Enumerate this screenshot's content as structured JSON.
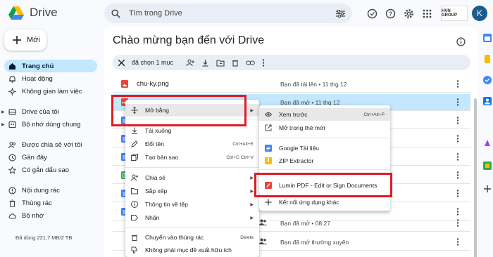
{
  "app": {
    "name": "Drive"
  },
  "search": {
    "placeholder": "Tìm trong Drive"
  },
  "header": {
    "brand_label": "HVN GROUP",
    "avatar_letter": "K"
  },
  "sidebar": {
    "new_label": "Mới",
    "items": [
      {
        "label": "Trang chủ",
        "icon": "home-icon",
        "active": true
      },
      {
        "label": "Hoạt động",
        "icon": "bell-icon"
      },
      {
        "label": "Không gian làm việc",
        "icon": "workspace-icon"
      },
      {
        "label": "Drive của tôi",
        "icon": "drive-icon"
      },
      {
        "label": "Bộ nhớ dùng chung",
        "icon": "shared-drive-icon"
      },
      {
        "label": "Được chia sẻ với tôi",
        "icon": "people-icon"
      },
      {
        "label": "Gần đây",
        "icon": "clock-icon"
      },
      {
        "label": "Có gắn dấu sao",
        "icon": "star-icon"
      },
      {
        "label": "Nội dung rác",
        "icon": "spam-icon"
      },
      {
        "label": "Thùng rác",
        "icon": "trash-icon"
      },
      {
        "label": "Bộ nhớ",
        "icon": "cloud-icon"
      }
    ],
    "storage_text": "Đã dùng 221,7 MB/2 TB"
  },
  "main": {
    "title": "Chào mừng bạn đến với Drive",
    "selection_text": "đã chọn 1 mục",
    "files": [
      {
        "name": "chu-ky.png",
        "reason": "Bạn đã tải lên • 11 thg 12",
        "type": "image"
      },
      {
        "name": "",
        "reason": "Bạn đã mở • 11 thg 12",
        "type": "pdf",
        "selected": true
      },
      {
        "name": "",
        "reason": "",
        "type": "doc"
      },
      {
        "name": "",
        "reason": "",
        "type": "doc"
      },
      {
        "name": "",
        "reason": "",
        "type": "doc"
      },
      {
        "name": "",
        "reason": "",
        "type": "sheet"
      },
      {
        "name": "",
        "reason": "",
        "type": "doc"
      },
      {
        "name": "",
        "reason": "",
        "type": "doc"
      },
      {
        "name": "",
        "reason": "Bạn đã mở • 08:27",
        "type": "shared"
      },
      {
        "name": "",
        "reason": "Bạn đã mở thường xuyên",
        "type": "sheet"
      }
    ]
  },
  "context_menu": {
    "items": [
      {
        "label": "Mở bằng",
        "shortcut": "",
        "submenu": true
      },
      {
        "label": "Tải xuống",
        "shortcut": ""
      },
      {
        "label": "Đổi tên",
        "shortcut": "Ctrl+Alt+E"
      },
      {
        "label": "Tạo bản sao",
        "shortcut": "Ctrl+C Ctrl+V"
      },
      {
        "label": "Chia sẻ",
        "shortcut": "",
        "submenu": true
      },
      {
        "label": "Sắp xếp",
        "shortcut": "",
        "submenu": true
      },
      {
        "label": "Thông tin về tệp",
        "shortcut": "",
        "submenu": true
      },
      {
        "label": "Nhãn",
        "shortcut": "",
        "submenu": true
      },
      {
        "label": "Chuyển vào thùng rác",
        "shortcut": "Delete"
      },
      {
        "label": "Không phải mục đề xuất hữu ích",
        "shortcut": ""
      }
    ]
  },
  "open_with_menu": {
    "items": [
      {
        "label": "Xem trước",
        "shortcut": "Ctrl+Alt+P"
      },
      {
        "label": "Mở trong thẻ mới",
        "shortcut": ""
      },
      {
        "label": "Google Tài liệu",
        "shortcut": ""
      },
      {
        "label": "ZIP Extractor",
        "shortcut": ""
      },
      {
        "label": "Lumin PDF - Edit or Sign Documents",
        "shortcut": ""
      },
      {
        "label": "Kết nối ứng dụng khác",
        "shortcut": ""
      }
    ]
  },
  "colors": {
    "accent": "#c2e7ff",
    "highlight": "#e01b24",
    "pdf": "#ea4335",
    "doc": "#4285f4",
    "sheet": "#34a853"
  }
}
